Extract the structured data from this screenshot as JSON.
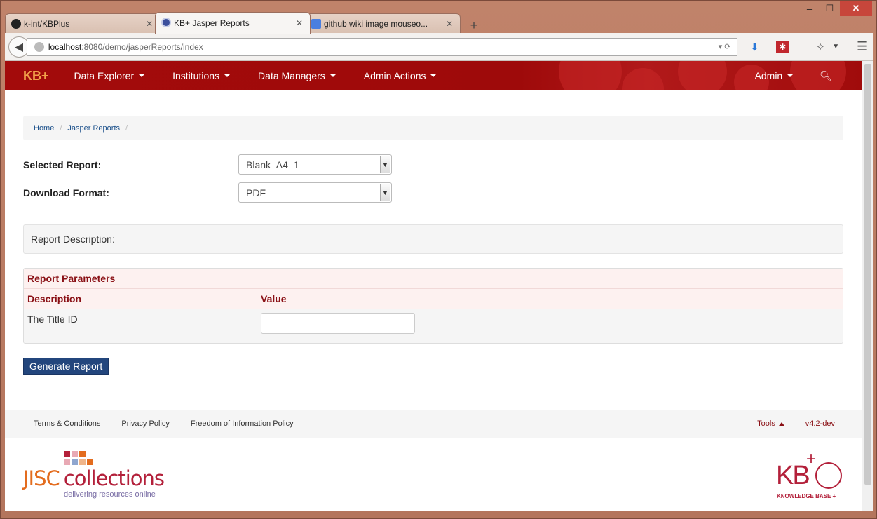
{
  "window": {
    "controls": {
      "minimize": "–",
      "maximize": "☐",
      "close": "✕"
    }
  },
  "tabs": [
    {
      "label": "k-int/KBPlus",
      "icon": "github-icon"
    },
    {
      "label": "KB+ Jasper Reports",
      "icon": "kb-icon"
    },
    {
      "label": "github wiki image mouseo...",
      "icon": "google-icon"
    }
  ],
  "toolbar": {
    "url_host": "localhost",
    "url_rest": ":8080/demo/jasperReports/index"
  },
  "navbar": {
    "brand": "KB+",
    "items": [
      "Data Explorer",
      "Institutions",
      "Data Managers",
      "Admin Actions"
    ],
    "user_menu": "Admin"
  },
  "breadcrumb": [
    "Home",
    "Jasper Reports"
  ],
  "form": {
    "selected_report_label": "Selected Report:",
    "selected_report_value": "Blank_A4_1",
    "download_format_label": "Download Format:",
    "download_format_value": "PDF"
  },
  "description": {
    "label": "Report Description:"
  },
  "params": {
    "title": "Report Parameters",
    "columns": [
      "Description",
      "Value"
    ],
    "rows": [
      {
        "description": "The Title ID",
        "value": ""
      }
    ]
  },
  "generate_button": "Generate Report",
  "footer": {
    "links": [
      "Terms & Conditions",
      "Privacy Policy",
      "Freedom of Information Policy"
    ],
    "tools": "Tools",
    "version": "v4.2-dev"
  },
  "logos": {
    "jisc_word": "JISC",
    "collections_word": "collections",
    "jisc_tagline": "delivering resources online",
    "kb_word": "KB",
    "kb_plus": "+",
    "kb_tagline": "KNOWLEDGE BASE +"
  },
  "colors": {
    "navbar": "#a30b0b",
    "brand_text": "#f2a14a",
    "table_header_text": "#8a1015",
    "button": "#23467d"
  }
}
